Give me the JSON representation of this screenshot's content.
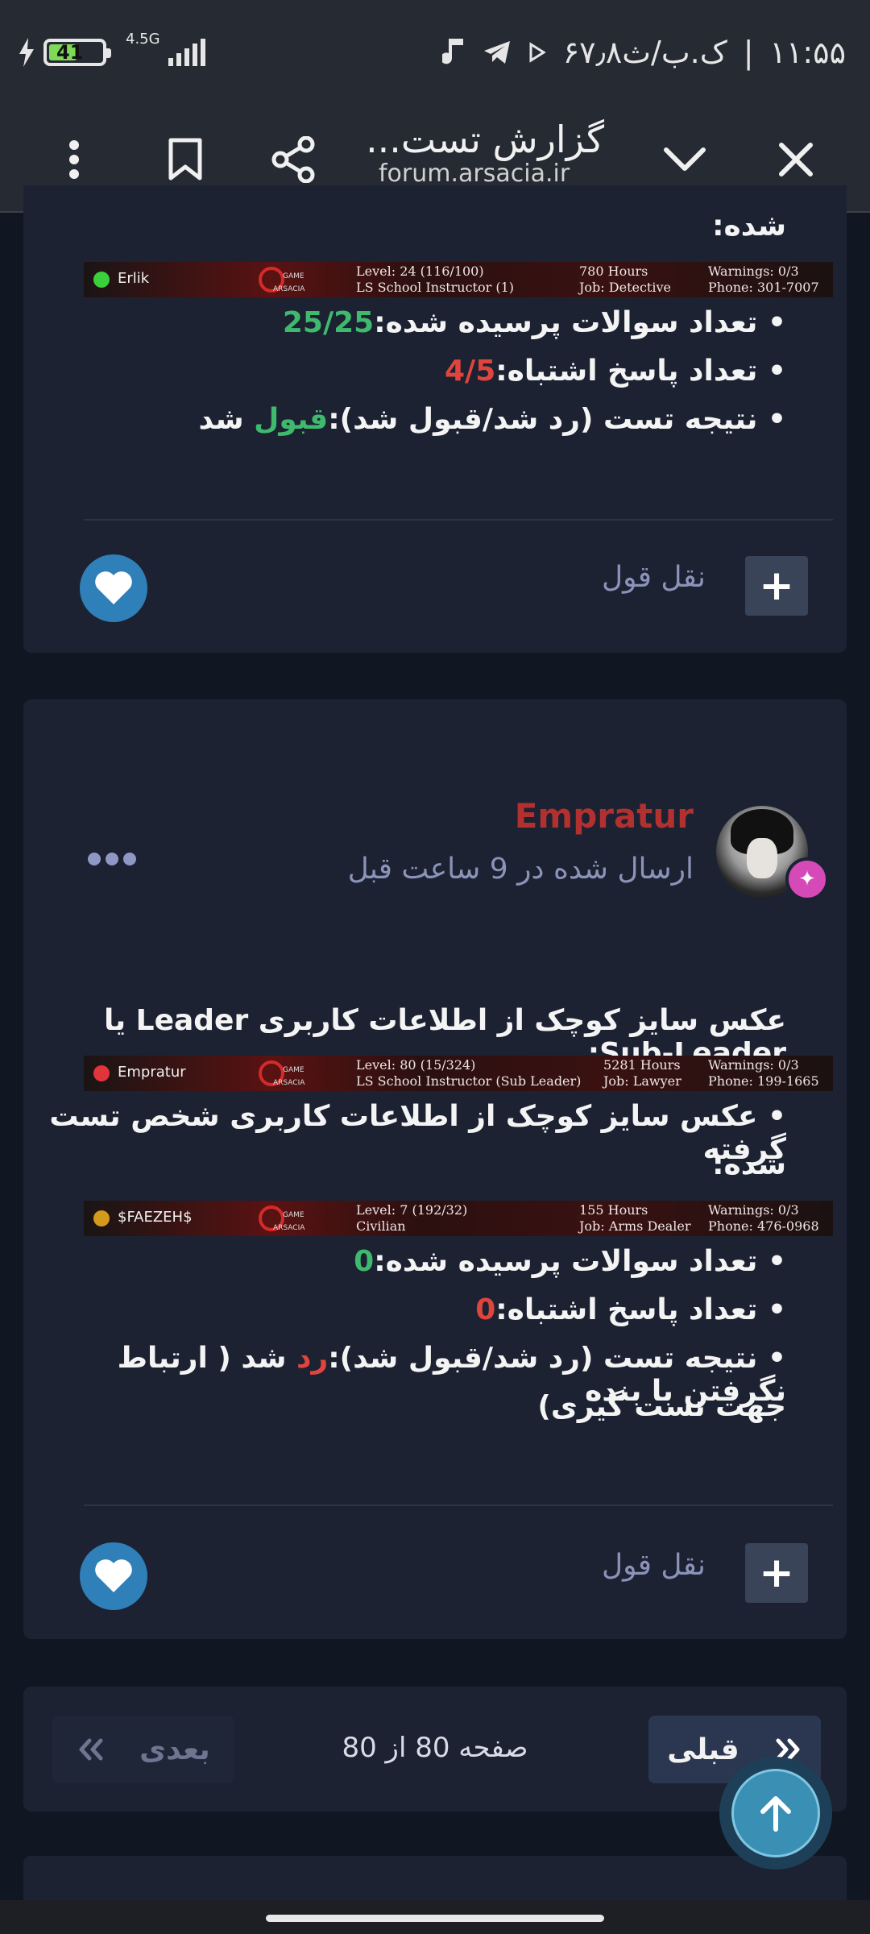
{
  "status_bar": {
    "time": "۱۱:۵۵",
    "date": "۶۷٫۸ک.ب/ث",
    "battery": "41",
    "network": "4.5G"
  },
  "browser": {
    "title": "گزارش تست...",
    "url": "forum.arsacia.ir"
  },
  "post1": {
    "line_shode": "شده:",
    "signature": {
      "name": "Erlik",
      "status_color": "#3ccf3c",
      "col1_line1": "Level: 24 (116/100)",
      "col1_line2": "LS School Instructor (1)",
      "col2_line1": "780 Hours",
      "col2_line2": "Job: Detective",
      "col3_line1": "Warnings: 0/3",
      "col3_line2": "Phone: 301-7007"
    },
    "questions_label": "• تعداد سوالات پرسیده شده:",
    "questions_value": "25/25",
    "wrong_label": "• تعداد پاسخ اشتباه:",
    "wrong_value": "4/5",
    "result_label": "• نتیجه تست (رد شد/قبول شد):",
    "result_value": "قبول",
    "result_suffix": " شد",
    "quote_label": "نقل قول"
  },
  "post2": {
    "author": "Empratur",
    "posted": "ارسال شده در 9 ساعت قبل",
    "intro": "عکس سایز کوچک از اطلاعات کاربری Leader یا Sub-Leader:",
    "signature1": {
      "name": "Empratur",
      "status_color": "#e0353a",
      "col1_line1": "Level: 80 (15/324)",
      "col1_line2": "LS School Instructor (Sub Leader)",
      "col2_line1": "5281 Hours",
      "col2_line2": "Job: Lawyer",
      "col3_line1": "Warnings: 0/3",
      "col3_line2": "Phone: 199-1665"
    },
    "tested_line1": "• عکس سایز کوچک از اطلاعات کاربری شخص تست گرفته",
    "tested_line2": "شده:",
    "signature2": {
      "name": "$FAEZEH$",
      "status_color": "#d49a1c",
      "col1_line1": "Level: 7 (192/32)",
      "col1_line2": "Civilian",
      "col2_line1": "155 Hours",
      "col2_line2": "Job: Arms Dealer",
      "col3_line1": "Warnings: 0/3",
      "col3_line2": "Phone: 476-0968"
    },
    "questions_label": "• تعداد سوالات پرسیده شده:",
    "questions_value": "0",
    "wrong_label": "• تعداد پاسخ اشتباه:",
    "wrong_value": "0",
    "result_label": "• نتیجه تست (رد شد/قبول شد):",
    "result_value": "رد",
    "result_suffix": " شد ( ارتباط نگرفتن با بنده",
    "result_line2": "جهت تست گیری)",
    "quote_label": "نقل قول"
  },
  "pagination": {
    "prev_label": "قبلی",
    "next_label": "بعدی",
    "page_info": "صفحه 80 از 80"
  },
  "colors": {
    "accent_green": "#3fb96d",
    "accent_red": "#e0453d",
    "author_red": "#b33030",
    "card_bg": "#1c2232"
  }
}
